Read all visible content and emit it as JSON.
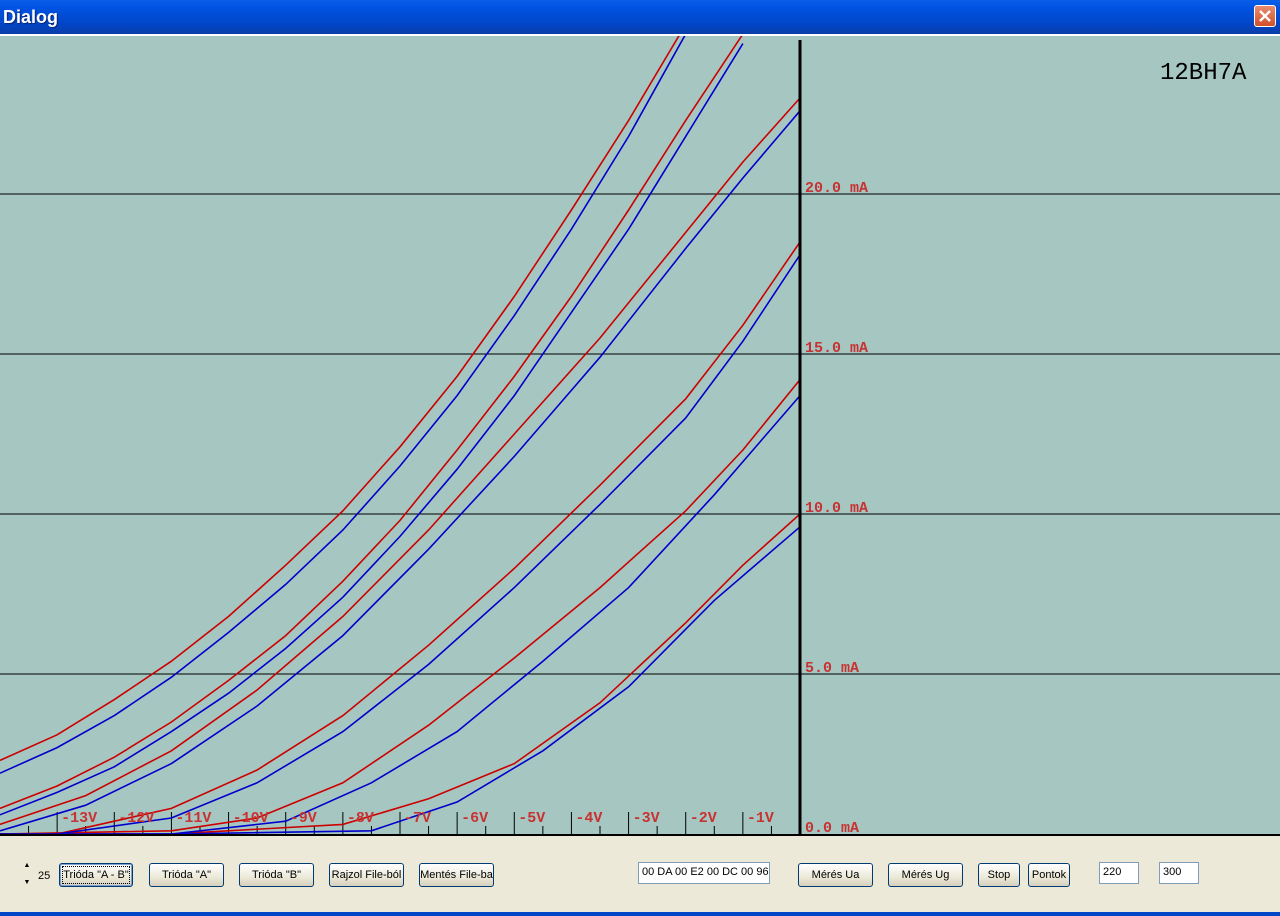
{
  "window": {
    "title": "Dialog"
  },
  "plot": {
    "tube_label": "12BH7A",
    "colors": {
      "background": "#a6c7c1",
      "series_a": "#cc0000",
      "series_b": "#0000cc",
      "label": "#c83232"
    }
  },
  "chart_data": {
    "type": "line",
    "title": "12BH7A",
    "x_unit": "V",
    "y_unit": "mA",
    "xlim": [
      -14,
      0
    ],
    "ylim": [
      0,
      25
    ],
    "y_ticks": [
      "0.0 mA",
      "5.0 mA",
      "10.0 mA",
      "15.0 mA",
      "20.0 mA"
    ],
    "y_tick_values": [
      0,
      5,
      10,
      15,
      20
    ],
    "x_ticks": [
      "-13V",
      "-12V",
      "-11V",
      "-10V",
      "-9V",
      "-8V",
      "-7V",
      "-6V",
      "-5V",
      "-4V",
      "-3V",
      "-2V",
      "-1V"
    ],
    "x_tick_values": [
      -13,
      -12,
      -11,
      -10,
      -9,
      -8,
      -7,
      -6,
      -5,
      -4,
      -3,
      -2,
      -1
    ],
    "grid": true,
    "series": [
      {
        "values": [
          [
            -14,
            0
          ],
          [
            -11,
            0
          ],
          [
            -8,
            0.3
          ],
          [
            -6.5,
            1.1
          ],
          [
            -5,
            2.2
          ],
          [
            -3.5,
            4.1
          ],
          [
            -2,
            6.6
          ],
          [
            -1,
            8.4
          ],
          [
            0,
            10
          ]
        ],
        "color": "#cc0000"
      },
      {
        "values": [
          [
            -14,
            0
          ],
          [
            -11,
            0
          ],
          [
            -7.5,
            0.1
          ],
          [
            -6,
            1.0
          ],
          [
            -4.5,
            2.6
          ],
          [
            -3,
            4.6
          ],
          [
            -1.5,
            7.3
          ],
          [
            0,
            9.6
          ]
        ],
        "color": "#0000cc"
      },
      {
        "values": [
          [
            -14,
            0
          ],
          [
            -11,
            0.1
          ],
          [
            -9.5,
            0.5
          ],
          [
            -8,
            1.6
          ],
          [
            -6.5,
            3.4
          ],
          [
            -5,
            5.5
          ],
          [
            -3.5,
            7.7
          ],
          [
            -2,
            10.1
          ],
          [
            -1,
            12
          ],
          [
            0,
            14.2
          ]
        ],
        "color": "#cc0000"
      },
      {
        "values": [
          [
            -14,
            0
          ],
          [
            -11,
            0
          ],
          [
            -9,
            0.4
          ],
          [
            -7.5,
            1.6
          ],
          [
            -6,
            3.2
          ],
          [
            -4.5,
            5.4
          ],
          [
            -3,
            7.7
          ],
          [
            -1.5,
            10.6
          ],
          [
            0,
            13.7
          ]
        ],
        "color": "#0000cc"
      },
      {
        "values": [
          [
            -14,
            0
          ],
          [
            -13,
            0
          ],
          [
            -11,
            0.8
          ],
          [
            -9.5,
            2.0
          ],
          [
            -8,
            3.7
          ],
          [
            -6.5,
            5.9
          ],
          [
            -5,
            8.3
          ],
          [
            -3.5,
            10.9
          ],
          [
            -2,
            13.6
          ],
          [
            -1,
            15.9
          ],
          [
            0,
            18.5
          ]
        ],
        "color": "#cc0000"
      },
      {
        "values": [
          [
            -14,
            0
          ],
          [
            -13,
            0
          ],
          [
            -11,
            0.5
          ],
          [
            -9.5,
            1.6
          ],
          [
            -8,
            3.2
          ],
          [
            -6.5,
            5.3
          ],
          [
            -5,
            7.7
          ],
          [
            -3.5,
            10.3
          ],
          [
            -2,
            13
          ],
          [
            -1,
            15.4
          ],
          [
            0,
            18.1
          ]
        ],
        "color": "#0000cc"
      },
      {
        "values": [
          [
            -14,
            0.3
          ],
          [
            -12.5,
            1.2
          ],
          [
            -11,
            2.6
          ],
          [
            -9.5,
            4.5
          ],
          [
            -8,
            6.8
          ],
          [
            -6.5,
            9.5
          ],
          [
            -5,
            12.5
          ],
          [
            -3.5,
            15.5
          ],
          [
            -2,
            18.8
          ],
          [
            -1,
            21
          ],
          [
            0,
            23
          ]
        ],
        "color": "#cc0000"
      },
      {
        "values": [
          [
            -14,
            0.1
          ],
          [
            -12.5,
            0.9
          ],
          [
            -11,
            2.2
          ],
          [
            -9.5,
            4.0
          ],
          [
            -8,
            6.2
          ],
          [
            -6.5,
            8.9
          ],
          [
            -5,
            11.8
          ],
          [
            -3.5,
            14.9
          ],
          [
            -2,
            18.3
          ],
          [
            -1,
            20.5
          ],
          [
            0,
            22.6
          ]
        ],
        "color": "#0000cc"
      },
      {
        "values": [
          [
            -14,
            0.8
          ],
          [
            -13,
            1.5
          ],
          [
            -12,
            2.4
          ],
          [
            -11,
            3.5
          ],
          [
            -10,
            4.8
          ],
          [
            -9,
            6.2
          ],
          [
            -8,
            7.9
          ],
          [
            -7,
            9.8
          ],
          [
            -6,
            12
          ],
          [
            -5,
            14.3
          ],
          [
            -4,
            16.8
          ],
          [
            -3,
            19.5
          ],
          [
            -2,
            22.3
          ],
          [
            -1,
            25
          ]
        ],
        "color": "#cc0000"
      },
      {
        "values": [
          [
            -14,
            0.6
          ],
          [
            -13,
            1.3
          ],
          [
            -12,
            2.1
          ],
          [
            -11,
            3.2
          ],
          [
            -10,
            4.4
          ],
          [
            -9,
            5.8
          ],
          [
            -8,
            7.4
          ],
          [
            -7,
            9.3
          ],
          [
            -6,
            11.4
          ],
          [
            -5,
            13.7
          ],
          [
            -4,
            16.3
          ],
          [
            -3,
            18.9
          ],
          [
            -2,
            21.8
          ],
          [
            -1,
            24.7
          ]
        ],
        "color": "#0000cc"
      },
      {
        "values": [
          [
            -14,
            2.3
          ],
          [
            -13,
            3.1
          ],
          [
            -12,
            4.2
          ],
          [
            -11,
            5.4
          ],
          [
            -10,
            6.8
          ],
          [
            -9,
            8.4
          ],
          [
            -8,
            10.1
          ],
          [
            -7,
            12.1
          ],
          [
            -6,
            14.3
          ],
          [
            -5,
            16.8
          ],
          [
            -4,
            19.5
          ],
          [
            -3,
            22.3
          ],
          [
            -2.1,
            25
          ]
        ],
        "color": "#cc0000"
      },
      {
        "values": [
          [
            -14,
            1.9
          ],
          [
            -13,
            2.7
          ],
          [
            -12,
            3.7
          ],
          [
            -11,
            4.9
          ],
          [
            -10,
            6.3
          ],
          [
            -9,
            7.8
          ],
          [
            -8,
            9.5
          ],
          [
            -7,
            11.5
          ],
          [
            -6,
            13.7
          ],
          [
            -5,
            16.2
          ],
          [
            -4,
            18.9
          ],
          [
            -3,
            21.8
          ],
          [
            -2,
            25
          ]
        ],
        "color": "#0000cc"
      }
    ]
  },
  "toolbar": {
    "spinner_value": "25",
    "btn_trioda_ab": "Trióda \"A - B\"",
    "btn_trioda_a": "Trióda  \"A\"",
    "btn_trioda_b": "Trióda  \"B\"",
    "btn_rajzol": "Rajzol File-ból",
    "btn_mentes": "Mentés File-ba",
    "hex_field": "00 DA 00 E2 00 DC 00 96",
    "btn_meres_ua": "Mérés Ua",
    "btn_meres_ug": "Mérés Ug",
    "btn_stop": "Stop",
    "btn_pontok": "Pontok",
    "field_1": "220",
    "field_2": "300"
  }
}
